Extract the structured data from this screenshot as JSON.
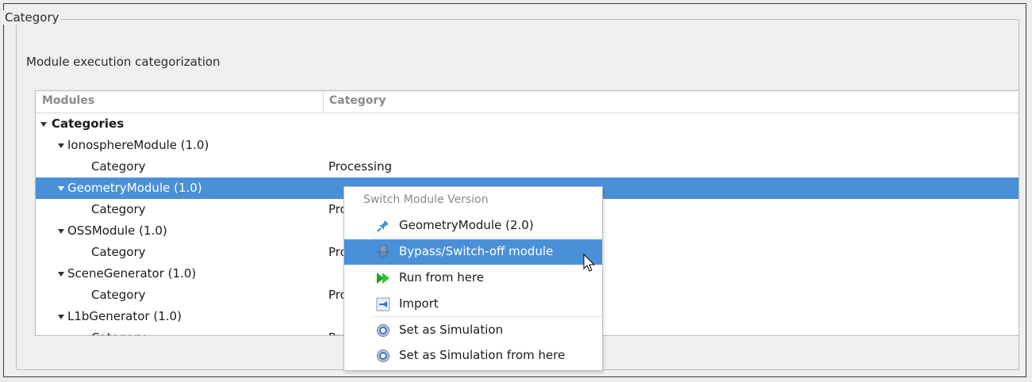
{
  "group": {
    "title": "Category",
    "description": "Module execution categorization"
  },
  "tree": {
    "columns": [
      "Modules",
      "Category"
    ],
    "rows": [
      {
        "label": "Categories",
        "value": "",
        "level": 0,
        "expanded": true,
        "bold": true
      },
      {
        "label": "IonosphereModule (1.0)",
        "value": "",
        "level": 1,
        "expanded": true
      },
      {
        "label": "Category",
        "value": "Processing",
        "level": 2
      },
      {
        "label": "GeometryModule (1.0)",
        "value": "",
        "level": 1,
        "expanded": true,
        "selected": true
      },
      {
        "label": "Category",
        "value": "Pro",
        "level": 2
      },
      {
        "label": "OSSModule (1.0)",
        "value": "",
        "level": 1,
        "expanded": true
      },
      {
        "label": "Category",
        "value": "Pro",
        "level": 2
      },
      {
        "label": "SceneGenerator (1.0)",
        "value": "",
        "level": 1,
        "expanded": true
      },
      {
        "label": "Category",
        "value": "Pro",
        "level": 2
      },
      {
        "label": "L1bGenerator (1.0)",
        "value": "",
        "level": 1,
        "expanded": true
      },
      {
        "label": "Category",
        "value": "Pro",
        "level": 2
      }
    ]
  },
  "context_menu": {
    "title": "Switch Module Version",
    "items": [
      {
        "label": "GeometryModule (2.0)",
        "icon": "pin-icon"
      },
      {
        "label": "Bypass/Switch-off module",
        "icon": "bypass-icon",
        "highlighted": true
      },
      {
        "label": "Run from here",
        "icon": "run-forward-icon"
      },
      {
        "label": "Import",
        "icon": "import-icon"
      },
      {
        "label": "Set as Simulation",
        "icon": "gear-icon"
      },
      {
        "label": "Set as Simulation from here",
        "icon": "gear-icon"
      }
    ]
  },
  "colors": {
    "selection": "#4a90d9",
    "background": "#efefef"
  }
}
